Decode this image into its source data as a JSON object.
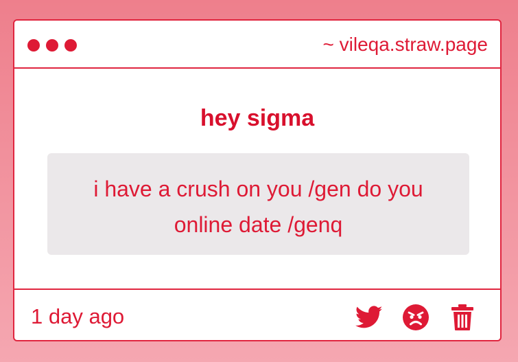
{
  "window": {
    "site": "~ vileqa.straw.page",
    "dots": [
      "dot",
      "dot",
      "dot"
    ]
  },
  "message": {
    "title": "hey sigma",
    "body": "i have a crush on you /gen do you online date /genq"
  },
  "footer": {
    "time": "1 day ago",
    "actions": [
      "twitter-icon",
      "angry-face-icon",
      "trash-icon"
    ]
  },
  "colors": {
    "accent": "#de1a35",
    "background_top": "#ee7f8c",
    "background_bottom": "#f5a7b1",
    "message_bg": "#ebe8ea"
  }
}
